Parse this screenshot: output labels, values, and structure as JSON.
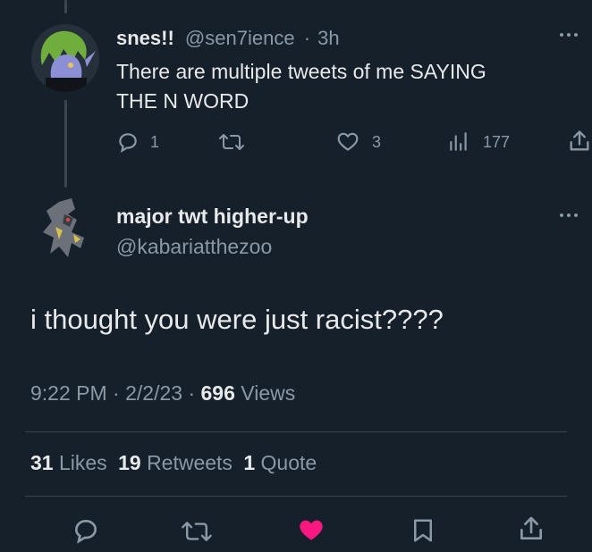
{
  "parent_tweet": {
    "display_name": "snes!!",
    "handle": "@sen7ience",
    "separator": "·",
    "time": "3h",
    "text_line1": "There are multiple tweets of me SAYING",
    "text_line2": "THE N WORD",
    "reply_count": "1",
    "like_count": "3",
    "view_count": "177"
  },
  "main_tweet": {
    "display_name": "major twt higher-up",
    "handle": "@kabariatthezoo",
    "text": "i thought you were just racist????",
    "time": "9:22 PM",
    "sep1": "·",
    "date": "2/2/23",
    "sep2": "·",
    "views_count": "696",
    "views_label": "Views",
    "likes_count": "31",
    "likes_label": "Likes",
    "retweets_count": "19",
    "retweets_label": "Retweets",
    "quotes_count": "1",
    "quotes_label": "Quote"
  },
  "colors": {
    "background": "#15202b",
    "text": "#e7e9ea",
    "muted": "#8b98a5",
    "like_active": "#f91880",
    "divider": "#38444d"
  },
  "icons": [
    "more-icon",
    "reply-icon",
    "retweet-icon",
    "like-icon",
    "views-icon",
    "share-icon",
    "bookmark-icon"
  ]
}
